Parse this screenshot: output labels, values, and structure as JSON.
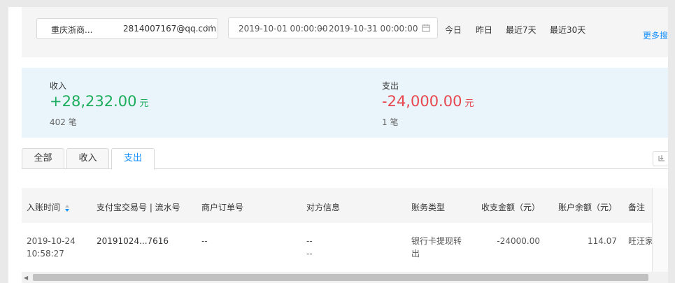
{
  "filter": {
    "account_name": "重庆浙商...",
    "account_email": "2814007167@qq.com",
    "date_start": "2019-10-01 00:00:00",
    "date_sep": "~",
    "date_end": "2019-10-31 00:00:00",
    "quick_ranges": [
      "今日",
      "昨日",
      "最近7天",
      "最近30天"
    ],
    "more_label": "更多搜"
  },
  "summary": {
    "income": {
      "label": "收入",
      "amount": "+28,232.00",
      "unit": "元",
      "count": "402 笔"
    },
    "expense": {
      "label": "支出",
      "amount": "-24,000.00",
      "unit": "元",
      "count": "1 笔"
    }
  },
  "tabs": [
    {
      "label": "全部",
      "active": false
    },
    {
      "label": "收入",
      "active": false
    },
    {
      "label": "支出",
      "active": true
    }
  ],
  "table": {
    "columns": [
      "入账时间",
      "支付宝交易号 | 流水号",
      "商户订单号",
      "对方信息",
      "账务类型",
      "收支金额（元）",
      "账户余额（元）",
      "备注"
    ],
    "rows": [
      {
        "time_date": "2019-10-24",
        "time_clock": "10:58:27",
        "trade_no": "20191024...7616",
        "merchant_order": "--",
        "counterparty_1": "--",
        "counterparty_2": "--",
        "type_1": "银行卡提现转",
        "type_2": "出",
        "amount": "-24000.00",
        "balance": "114.07",
        "note": "旺汪家"
      }
    ]
  },
  "colors": {
    "income": "#1aad5b",
    "expense": "#e8474f",
    "accent": "#1890ff"
  }
}
